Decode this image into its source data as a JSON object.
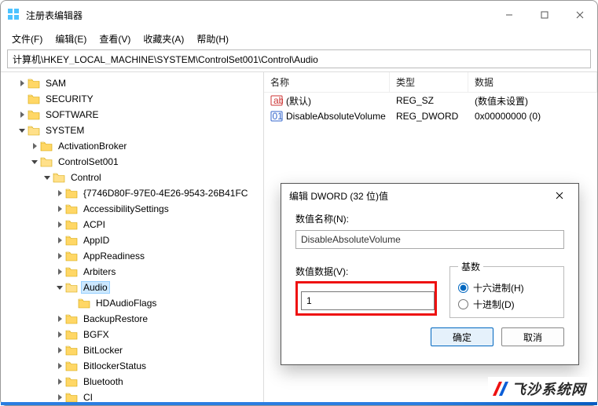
{
  "window": {
    "title": "注册表编辑器"
  },
  "menu": {
    "items": [
      "文件(F)",
      "编辑(E)",
      "查看(V)",
      "收藏夹(A)",
      "帮助(H)"
    ]
  },
  "address": {
    "value": "计算机\\HKEY_LOCAL_MACHINE\\SYSTEM\\ControlSet001\\Control\\Audio"
  },
  "tree": {
    "nodes": [
      {
        "indent": 1,
        "expand": "right",
        "label": "SAM"
      },
      {
        "indent": 1,
        "expand": "none",
        "label": "SECURITY"
      },
      {
        "indent": 1,
        "expand": "right",
        "label": "SOFTWARE"
      },
      {
        "indent": 1,
        "expand": "down",
        "label": "SYSTEM"
      },
      {
        "indent": 2,
        "expand": "right",
        "label": "ActivationBroker"
      },
      {
        "indent": 2,
        "expand": "down",
        "label": "ControlSet001"
      },
      {
        "indent": 3,
        "expand": "down",
        "label": "Control"
      },
      {
        "indent": 4,
        "expand": "right",
        "label": "{7746D80F-97E0-4E26-9543-26B41FC"
      },
      {
        "indent": 4,
        "expand": "right",
        "label": "AccessibilitySettings"
      },
      {
        "indent": 4,
        "expand": "right",
        "label": "ACPI"
      },
      {
        "indent": 4,
        "expand": "right",
        "label": "AppID"
      },
      {
        "indent": 4,
        "expand": "right",
        "label": "AppReadiness"
      },
      {
        "indent": 4,
        "expand": "right",
        "label": "Arbiters"
      },
      {
        "indent": 4,
        "expand": "down",
        "label": "Audio",
        "selected": true
      },
      {
        "indent": 5,
        "expand": "none",
        "label": "HDAudioFlags"
      },
      {
        "indent": 4,
        "expand": "right",
        "label": "BackupRestore"
      },
      {
        "indent": 4,
        "expand": "right",
        "label": "BGFX"
      },
      {
        "indent": 4,
        "expand": "right",
        "label": "BitLocker"
      },
      {
        "indent": 4,
        "expand": "right",
        "label": "BitlockerStatus"
      },
      {
        "indent": 4,
        "expand": "right",
        "label": "Bluetooth"
      },
      {
        "indent": 4,
        "expand": "right",
        "label": "CI"
      }
    ]
  },
  "list": {
    "headers": {
      "name": "名称",
      "type": "类型",
      "data": "数据"
    },
    "rows": [
      {
        "icon": "string",
        "name": "(默认)",
        "type": "REG_SZ",
        "data": "(数值未设置)"
      },
      {
        "icon": "dword",
        "name": "DisableAbsoluteVolume",
        "type": "REG_DWORD",
        "data": "0x00000000 (0)"
      }
    ]
  },
  "dialog": {
    "title": "编辑 DWORD (32 位)值",
    "name_label": "数值名称(N):",
    "name_value": "DisableAbsoluteVolume",
    "data_label": "数值数据(V):",
    "data_value": "1",
    "base_legend": "基数",
    "radio_hex": "十六进制(H)",
    "radio_dec": "十进制(D)",
    "ok": "确定",
    "cancel": "取消"
  },
  "watermark": {
    "text": "飞沙系统网"
  }
}
